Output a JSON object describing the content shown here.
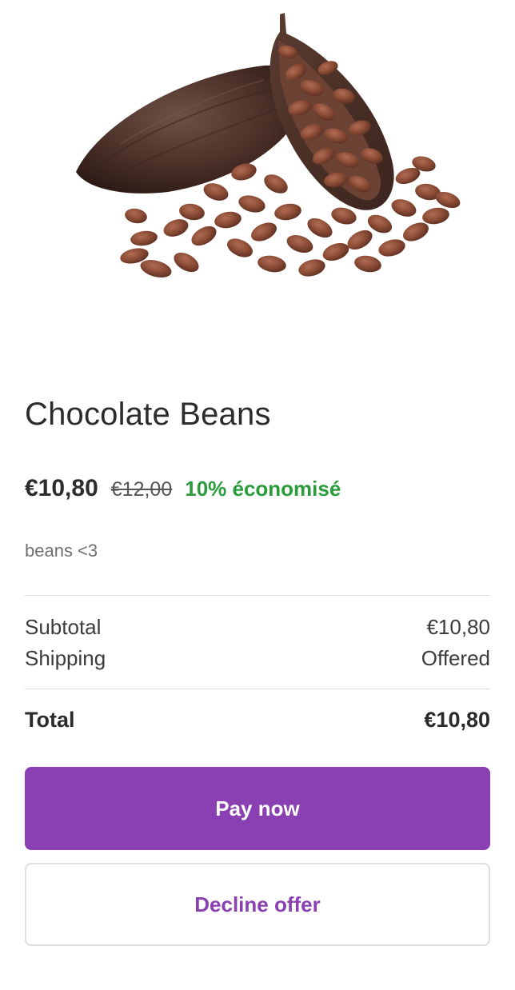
{
  "product": {
    "image_alt": "cocoa pod with cocoa beans",
    "title": "Chocolate Beans",
    "price_current": "€10,80",
    "price_original": "€12,00",
    "price_saving": "10% économisé",
    "description": "beans <3"
  },
  "summary": {
    "subtotal_label": "Subtotal",
    "subtotal_value": "€10,80",
    "shipping_label": "Shipping",
    "shipping_value": "Offered",
    "total_label": "Total",
    "total_value": "€10,80"
  },
  "actions": {
    "pay_label": "Pay now",
    "decline_label": "Decline offer"
  },
  "colors": {
    "accent": "#8a3fb3",
    "saving": "#2a9c3c",
    "bean_dark": "#5a3a30",
    "bean_light": "#8a4b35"
  }
}
